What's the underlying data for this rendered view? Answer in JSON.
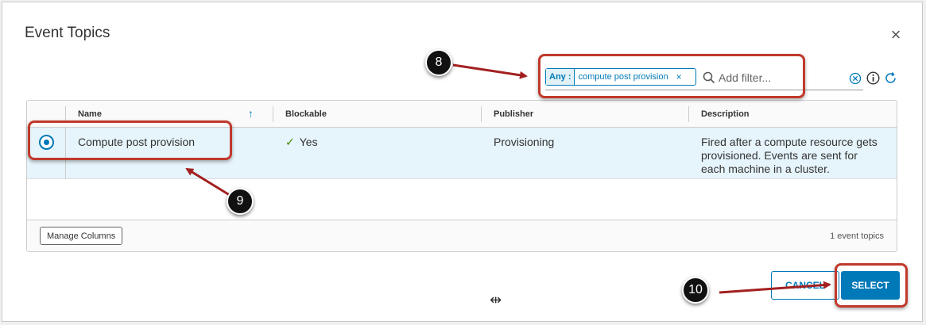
{
  "dialog": {
    "title": "Event Topics",
    "close_glyph": "×"
  },
  "filter": {
    "chip_key": "Any :",
    "chip_value": "compute post provision",
    "chip_remove": "×",
    "placeholder": "Add filter..."
  },
  "grid": {
    "columns": [
      {
        "label": "Name"
      },
      {
        "label": "Blockable"
      },
      {
        "label": "Publisher"
      },
      {
        "label": "Description"
      }
    ],
    "sort_glyph": "↑",
    "rows": [
      {
        "name": "Compute post provision",
        "blockable": "Yes",
        "publisher": "Provisioning",
        "description": "Fired after a compute resource gets provisioned. Events are sent for each machine in a cluster.",
        "selected": true
      }
    ],
    "manage_columns_label": "Manage Columns",
    "count_text": "1 event topics"
  },
  "footer": {
    "cancel_label": "CANCEL",
    "select_label": "SELECT",
    "resize_glyph": "⇹"
  },
  "annotations": {
    "step8": "8",
    "step9": "9",
    "step10": "10"
  },
  "icons": [
    "close-icon",
    "search-icon",
    "clear-icon",
    "info-icon",
    "refresh-icon",
    "checkmark-icon",
    "sort-ascending-icon",
    "resize-icon"
  ],
  "colors": {
    "accent": "#0079b8",
    "selected_row": "#e6f4fb",
    "annotation_red": "#c0392b",
    "check_green": "#3c8500"
  }
}
